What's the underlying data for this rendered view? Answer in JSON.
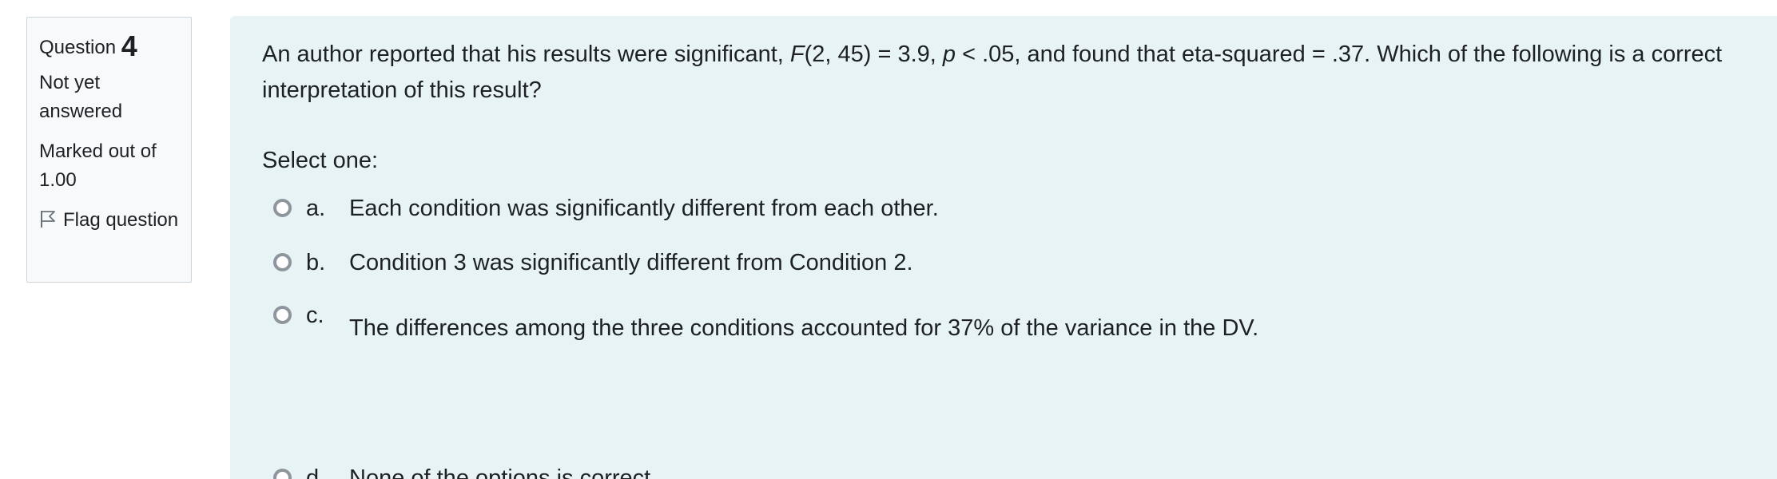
{
  "question": {
    "label": "Question",
    "number": "4",
    "state": "Not yet answered",
    "grade": "Marked out of 1.00",
    "flag_label": "Flag question"
  },
  "question_text": {
    "part1": "An author reported that his results were significant, ",
    "f_symbol": "F",
    "part2": "(2, 45) = 3.9, ",
    "p_symbol": "p",
    "part3": " < .05, and found that eta-squared = .37. Which of the following is a correct interpretation of this result?"
  },
  "prompt": "Select one:",
  "options": [
    {
      "letter": "a.",
      "text": "Each condition was significantly different from each other."
    },
    {
      "letter": "b.",
      "text": "Condition 3 was significantly different from Condition 2."
    },
    {
      "letter": "c.",
      "text": "The differences among the three conditions accounted for 37% of the variance in the DV."
    },
    {
      "letter": "d.",
      "text": "None of the options is correct."
    }
  ],
  "icons": {
    "flag": "flag-icon",
    "radio": "radio-icon"
  },
  "colors": {
    "content_bg": "#e7f3f5",
    "info_bg": "#f8f9fa",
    "info_border": "#cfd4d8",
    "radio_border": "#8f959e",
    "text": "#1d2125"
  }
}
